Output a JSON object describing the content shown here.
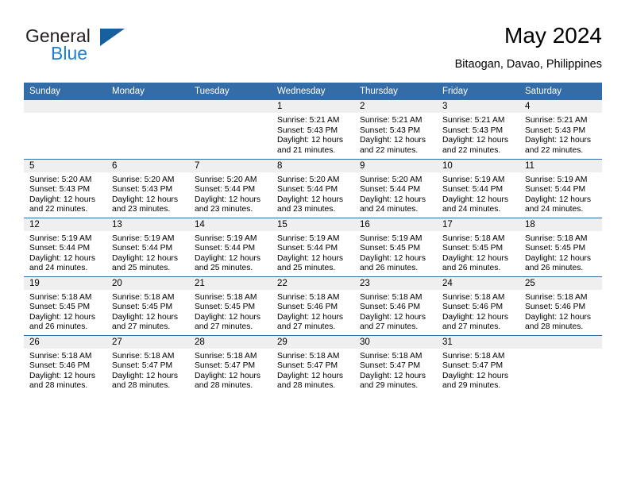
{
  "brand": {
    "name_part1": "General",
    "name_part2": "Blue",
    "accent_color": "#1f7fd0",
    "triangle_color": "#16609e"
  },
  "header": {
    "title": "May 2024",
    "subtitle": "Bitaogan, Davao, Philippines"
  },
  "theme": {
    "header_row_bg": "#336ca6",
    "header_row_text": "#ffffff",
    "daynum_bar_bg": "#efefef",
    "row_divider": "#336ca6"
  },
  "weekday_headers": [
    "Sunday",
    "Monday",
    "Tuesday",
    "Wednesday",
    "Thursday",
    "Friday",
    "Saturday"
  ],
  "labels": {
    "sunrise_prefix": "Sunrise: ",
    "sunset_prefix": "Sunset: ",
    "daylight_prefix": "Daylight: "
  },
  "weeks": [
    [
      {
        "empty": true
      },
      {
        "empty": true
      },
      {
        "empty": true
      },
      {
        "day": "1",
        "sunrise": "Sunrise: 5:21 AM",
        "sunset": "Sunset: 5:43 PM",
        "daylight_line1": "Daylight: 12 hours",
        "daylight_line2": "and 21 minutes."
      },
      {
        "day": "2",
        "sunrise": "Sunrise: 5:21 AM",
        "sunset": "Sunset: 5:43 PM",
        "daylight_line1": "Daylight: 12 hours",
        "daylight_line2": "and 22 minutes."
      },
      {
        "day": "3",
        "sunrise": "Sunrise: 5:21 AM",
        "sunset": "Sunset: 5:43 PM",
        "daylight_line1": "Daylight: 12 hours",
        "daylight_line2": "and 22 minutes."
      },
      {
        "day": "4",
        "sunrise": "Sunrise: 5:21 AM",
        "sunset": "Sunset: 5:43 PM",
        "daylight_line1": "Daylight: 12 hours",
        "daylight_line2": "and 22 minutes."
      }
    ],
    [
      {
        "day": "5",
        "sunrise": "Sunrise: 5:20 AM",
        "sunset": "Sunset: 5:43 PM",
        "daylight_line1": "Daylight: 12 hours",
        "daylight_line2": "and 22 minutes."
      },
      {
        "day": "6",
        "sunrise": "Sunrise: 5:20 AM",
        "sunset": "Sunset: 5:43 PM",
        "daylight_line1": "Daylight: 12 hours",
        "daylight_line2": "and 23 minutes."
      },
      {
        "day": "7",
        "sunrise": "Sunrise: 5:20 AM",
        "sunset": "Sunset: 5:44 PM",
        "daylight_line1": "Daylight: 12 hours",
        "daylight_line2": "and 23 minutes."
      },
      {
        "day": "8",
        "sunrise": "Sunrise: 5:20 AM",
        "sunset": "Sunset: 5:44 PM",
        "daylight_line1": "Daylight: 12 hours",
        "daylight_line2": "and 23 minutes."
      },
      {
        "day": "9",
        "sunrise": "Sunrise: 5:20 AM",
        "sunset": "Sunset: 5:44 PM",
        "daylight_line1": "Daylight: 12 hours",
        "daylight_line2": "and 24 minutes."
      },
      {
        "day": "10",
        "sunrise": "Sunrise: 5:19 AM",
        "sunset": "Sunset: 5:44 PM",
        "daylight_line1": "Daylight: 12 hours",
        "daylight_line2": "and 24 minutes."
      },
      {
        "day": "11",
        "sunrise": "Sunrise: 5:19 AM",
        "sunset": "Sunset: 5:44 PM",
        "daylight_line1": "Daylight: 12 hours",
        "daylight_line2": "and 24 minutes."
      }
    ],
    [
      {
        "day": "12",
        "sunrise": "Sunrise: 5:19 AM",
        "sunset": "Sunset: 5:44 PM",
        "daylight_line1": "Daylight: 12 hours",
        "daylight_line2": "and 24 minutes."
      },
      {
        "day": "13",
        "sunrise": "Sunrise: 5:19 AM",
        "sunset": "Sunset: 5:44 PM",
        "daylight_line1": "Daylight: 12 hours",
        "daylight_line2": "and 25 minutes."
      },
      {
        "day": "14",
        "sunrise": "Sunrise: 5:19 AM",
        "sunset": "Sunset: 5:44 PM",
        "daylight_line1": "Daylight: 12 hours",
        "daylight_line2": "and 25 minutes."
      },
      {
        "day": "15",
        "sunrise": "Sunrise: 5:19 AM",
        "sunset": "Sunset: 5:44 PM",
        "daylight_line1": "Daylight: 12 hours",
        "daylight_line2": "and 25 minutes."
      },
      {
        "day": "16",
        "sunrise": "Sunrise: 5:19 AM",
        "sunset": "Sunset: 5:45 PM",
        "daylight_line1": "Daylight: 12 hours",
        "daylight_line2": "and 26 minutes."
      },
      {
        "day": "17",
        "sunrise": "Sunrise: 5:18 AM",
        "sunset": "Sunset: 5:45 PM",
        "daylight_line1": "Daylight: 12 hours",
        "daylight_line2": "and 26 minutes."
      },
      {
        "day": "18",
        "sunrise": "Sunrise: 5:18 AM",
        "sunset": "Sunset: 5:45 PM",
        "daylight_line1": "Daylight: 12 hours",
        "daylight_line2": "and 26 minutes."
      }
    ],
    [
      {
        "day": "19",
        "sunrise": "Sunrise: 5:18 AM",
        "sunset": "Sunset: 5:45 PM",
        "daylight_line1": "Daylight: 12 hours",
        "daylight_line2": "and 26 minutes."
      },
      {
        "day": "20",
        "sunrise": "Sunrise: 5:18 AM",
        "sunset": "Sunset: 5:45 PM",
        "daylight_line1": "Daylight: 12 hours",
        "daylight_line2": "and 27 minutes."
      },
      {
        "day": "21",
        "sunrise": "Sunrise: 5:18 AM",
        "sunset": "Sunset: 5:45 PM",
        "daylight_line1": "Daylight: 12 hours",
        "daylight_line2": "and 27 minutes."
      },
      {
        "day": "22",
        "sunrise": "Sunrise: 5:18 AM",
        "sunset": "Sunset: 5:46 PM",
        "daylight_line1": "Daylight: 12 hours",
        "daylight_line2": "and 27 minutes."
      },
      {
        "day": "23",
        "sunrise": "Sunrise: 5:18 AM",
        "sunset": "Sunset: 5:46 PM",
        "daylight_line1": "Daylight: 12 hours",
        "daylight_line2": "and 27 minutes."
      },
      {
        "day": "24",
        "sunrise": "Sunrise: 5:18 AM",
        "sunset": "Sunset: 5:46 PM",
        "daylight_line1": "Daylight: 12 hours",
        "daylight_line2": "and 27 minutes."
      },
      {
        "day": "25",
        "sunrise": "Sunrise: 5:18 AM",
        "sunset": "Sunset: 5:46 PM",
        "daylight_line1": "Daylight: 12 hours",
        "daylight_line2": "and 28 minutes."
      }
    ],
    [
      {
        "day": "26",
        "sunrise": "Sunrise: 5:18 AM",
        "sunset": "Sunset: 5:46 PM",
        "daylight_line1": "Daylight: 12 hours",
        "daylight_line2": "and 28 minutes."
      },
      {
        "day": "27",
        "sunrise": "Sunrise: 5:18 AM",
        "sunset": "Sunset: 5:47 PM",
        "daylight_line1": "Daylight: 12 hours",
        "daylight_line2": "and 28 minutes."
      },
      {
        "day": "28",
        "sunrise": "Sunrise: 5:18 AM",
        "sunset": "Sunset: 5:47 PM",
        "daylight_line1": "Daylight: 12 hours",
        "daylight_line2": "and 28 minutes."
      },
      {
        "day": "29",
        "sunrise": "Sunrise: 5:18 AM",
        "sunset": "Sunset: 5:47 PM",
        "daylight_line1": "Daylight: 12 hours",
        "daylight_line2": "and 28 minutes."
      },
      {
        "day": "30",
        "sunrise": "Sunrise: 5:18 AM",
        "sunset": "Sunset: 5:47 PM",
        "daylight_line1": "Daylight: 12 hours",
        "daylight_line2": "and 29 minutes."
      },
      {
        "day": "31",
        "sunrise": "Sunrise: 5:18 AM",
        "sunset": "Sunset: 5:47 PM",
        "daylight_line1": "Daylight: 12 hours",
        "daylight_line2": "and 29 minutes."
      },
      {
        "empty": true
      }
    ]
  ]
}
